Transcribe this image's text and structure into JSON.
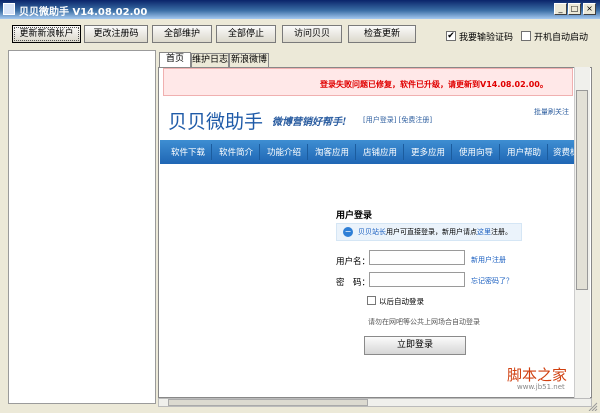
{
  "window": {
    "title": "贝贝微助手 V14.08.02.00",
    "minimize": "_",
    "maximize": "□",
    "close": "×"
  },
  "toolbar": {
    "buttons": [
      "更新新浪帐户",
      "更改注册码",
      "全部维护",
      "全部停止",
      "访问贝贝",
      "检查更新"
    ],
    "checkbox_captcha": {
      "label": "我要输验证码",
      "checked": true
    },
    "checkbox_autostart": {
      "label": "开机自动启动",
      "checked": false
    }
  },
  "tabs": [
    "首页",
    "维护日志",
    "新浪微博"
  ],
  "notice": "登录失败问题已修复，软件已升级，请更新到V14.08.02.00。",
  "site": {
    "logo": "贝贝微助手",
    "slogan": "微博营销好帮手!",
    "member_links": "[用户登录] [免费注册]",
    "batch_follow": "批量刷关注",
    "nav": [
      "软件下载",
      "软件简介",
      "功能介绍",
      "淘客应用",
      "店铺应用",
      "更多应用",
      "使用向导",
      "用户帮助",
      "资费标"
    ]
  },
  "login": {
    "title": "用户登录",
    "tip_prefix": "贝贝站长",
    "tip_middle": "用户可直接登录，新用户请点",
    "tip_link": "这里",
    "tip_suffix": "注册。",
    "username_label": "用户名：",
    "password_label": "密　码：",
    "register_link": "新用户注册",
    "forgot_link": "忘记密码了？",
    "remember_label": "以后自动登录",
    "warning": "请勿在网吧等公共上网场合自动登录",
    "submit": "立即登录"
  },
  "watermark": {
    "text": "脚本之家",
    "url": "www.jb51.net"
  },
  "colors": {
    "title_bar": "#0a246a",
    "nav_bar": "#2a78c6",
    "notice_text": "#e00000",
    "link": "#1a5fc0"
  }
}
